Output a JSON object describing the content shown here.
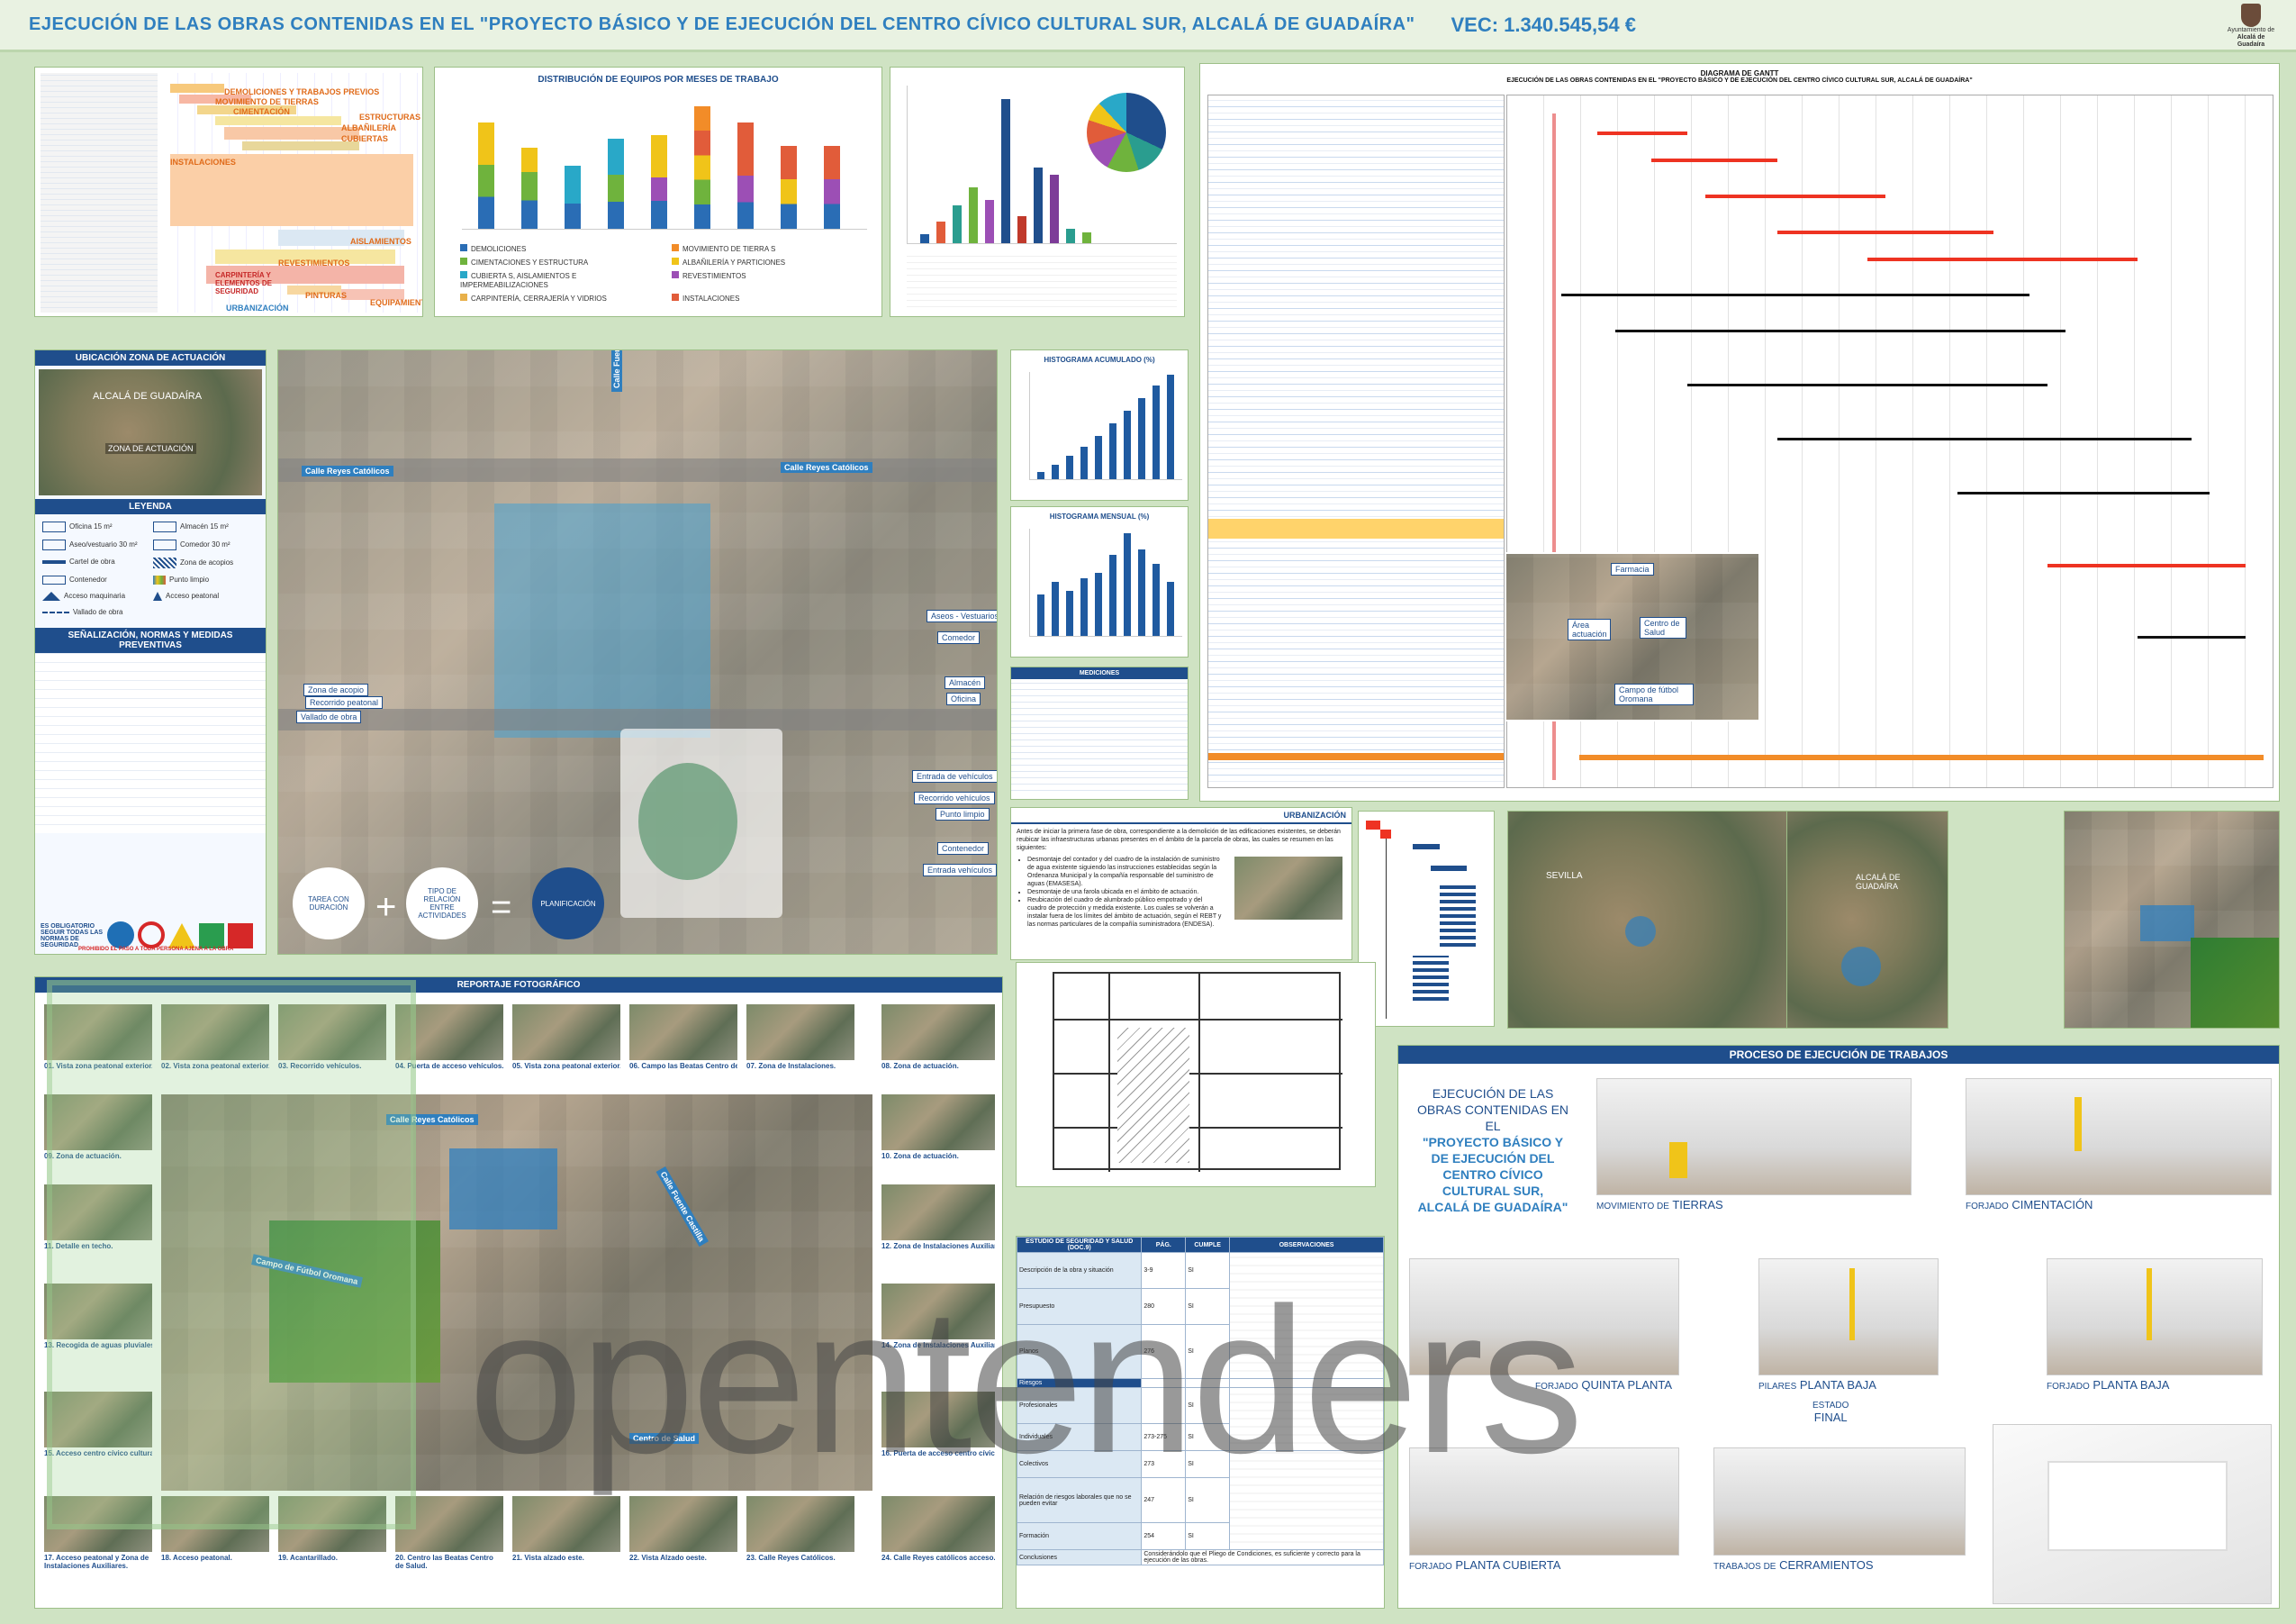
{
  "header": {
    "title": "EJECUCIÓN DE LAS OBRAS CONTENIDAS EN EL \"PROYECTO BÁSICO Y DE EJECUCIÓN DEL CENTRO CÍVICO CULTURAL SUR, ALCALÁ DE GUADAÍRA\"",
    "vec": "VEC: 1.340.545,54 €",
    "logo_line1": "Ayuntamiento de",
    "logo_line2": "Alcalá de Guadaíra"
  },
  "gantt_summary": {
    "phases": [
      "DEMOLICIONES Y TRABAJOS PREVIOS",
      "MOVIMIENTO DE TIERRAS",
      "CIMENTACIÓN",
      "ESTRUCTURAS",
      "ALBAÑILERÍA",
      "CUBIERTAS",
      "INSTALACIONES",
      "AISLAMIENTOS",
      "REVESTIMIENTOS",
      "CARPINTERÍA Y ELEMENTOS DE SEGURIDAD",
      "PINTURAS",
      "EQUIPAMIENTO",
      "URBANIZACIÓN"
    ]
  },
  "equipos_chart": {
    "title": "DISTRIBUCIÓN DE EQUIPOS POR MESES DE TRABAJO",
    "legend": [
      "DEMOLICIONES",
      "MOVIMIENTO DE TIERRA S",
      "CIMENTACIONES Y ESTRUCTURA",
      "ALBAÑILERÍA Y PARTICIONES",
      "CUBIERTA S, AISLAMIENTOS E IMPERMEABILIZACIONES",
      "REVESTIMIENTOS",
      "CARPINTERÍA, CERRAJERÍA Y VIDRIOS",
      "INSTALACIONES"
    ]
  },
  "historama": {
    "acumulado_title": "HISTOGRAMA ACUMULADO (%)",
    "mensual_title": "HISTOGRAMA MENSUAL (%)"
  },
  "gantt_big": {
    "title": "DIAGRAMA DE GANTT",
    "subtitle": "EJECUCIÓN DE LAS OBRAS CONTENIDAS EN EL \"PROYECTO BÁSICO Y DE EJECUCIÓN DEL CENTRO CÍVICO CULTURAL SUR, ALCALÁ DE GUADAÍRA\"",
    "map_labels": [
      "Farmacia",
      "Área actuación",
      "Centro de Salud",
      "Campo de fútbol Oromana"
    ]
  },
  "ubicacion": {
    "title": "UBICACIÓN ZONA DE ACTUACIÓN",
    "map_label1": "ALCALÁ DE GUADAÍRA",
    "map_label2": "ZONA DE ACTUACIÓN",
    "legend_title": "LEYENDA",
    "legend_items": [
      "Oficina 15 m²",
      "Almacén 15 m²",
      "Aseo/vestuario 30 m²",
      "Comedor 30 m²",
      "Cartel de obra",
      "Zona de acopios",
      "Contenedor",
      "Punto limpio",
      "Acceso maquinaria",
      "Acceso peatonal",
      "Vallado de obra"
    ]
  },
  "senalizacion": {
    "title": "SEÑALIZACIÓN, NORMAS Y MEDIDAS PREVENTIVAS",
    "obligatorio": "ES OBLIGATORIO SEGUIR TODAS LAS NORMAS DE SEGURIDAD",
    "prohibido": "PROHIBIDO EL PASO A TODA PERSONA AJENA A LA OBRA"
  },
  "plano": {
    "streets": [
      "Calle Reyes Católicos",
      "Calle Reyes Católicos",
      "Calle Fuente Castilla"
    ],
    "tags": [
      "Aseos - Vestuarios",
      "Comedor",
      "Zona de acopio",
      "Recorrido peatonal",
      "Vallado de obra",
      "Almacén",
      "Oficina",
      "Entrada de vehículos",
      "Recorrido vehículos",
      "Punto limpio",
      "Contenedor",
      "Entrada vehículos"
    ],
    "flow_a": "TAREA CON DURACIÓN",
    "flow_b": "TIPO DE RELACIÓN ENTRE ACTIVIDADES",
    "flow_c": "PLANIFICACIÓN"
  },
  "mediciones": {
    "title": "MEDICIONES"
  },
  "urbanizacion": {
    "title": "URBANIZACIÓN",
    "intro": "Antes de iniciar la primera fase de obra, correspondiente a la demolición de las edificaciones existentes, se deberán reubicar las infraestructuras urbanas presentes en el ámbito de la parcela de obras, las cuales se resumen en las siguientes:",
    "items": [
      "Desmontaje del contador y del cuadro de la instalación de suministro de agua existente siguiendo las instrucciones establecidas según la Ordenanza Municipal y la compañía responsable del suministro de aguas (EMASESA).",
      "Desmontaje de una farola ubicada en el ámbito de actuación.",
      "Reubicación del cuadro de alumbrado público empotrado y del cuadro de protección y medida existente. Los cuales se volverán a instalar fuera de los límites del ámbito de actuación, según el REBT y las normas particulares de la compañía suministradora (ENDESA)."
    ]
  },
  "mapas": {
    "sevilla": "SEVILLA",
    "alcala": "ALCALÁ DE GUADAÍRA"
  },
  "reportaje": {
    "title": "REPORTAJE FOTOGRÁFICO",
    "street1": "Calle Reyes Católicos",
    "street2": "Calle Fuente Castilla",
    "campo": "Campo de Fútbol Oromana",
    "centro": "Centro de Salud",
    "top_row": [
      "01. Vista zona peatonal exterior.",
      "02. Vista zona peatonal exterior.",
      "03. Recorrido vehículos.",
      "04. Puerta de acceso vehículos.",
      "05. Vista zona peatonal exterior.",
      "06. Campo las Beatas Centro de Salud.",
      "07. Zona de Instalaciones.",
      "08. Zona de actuación."
    ],
    "left_col": [
      "09. Zona de actuación.",
      "11. Detalle en techo.",
      "13. Recogida de aguas pluviales.",
      "15. Acceso centro cívico cultural."
    ],
    "right_col": [
      "10. Zona de actuación.",
      "12. Zona de Instalaciones Auxiliares.",
      "14. Zona de Instalaciones Auxiliares.",
      "16. Puerta de acceso centro cívico cultural."
    ],
    "bottom_row": [
      "17. Acceso peatonal y Zona de Instalaciones Auxiliares.",
      "18. Acceso peatonal.",
      "19. Acantarillado.",
      "20. Centro las Beatas Centro de Salud.",
      "21. Vista alzado este.",
      "22. Vista Alzado oeste.",
      "23. Calle Reyes Católicos.",
      "24. Calle Reyes católicos acceso."
    ]
  },
  "estudio": {
    "col1": "ESTUDIO DE SEGURIDAD Y SALUD (DOC.9)",
    "col2": "PÁG.",
    "col3": "CUMPLE",
    "col4": "OBSERVACIONES",
    "rows": [
      {
        "name": "Descripción de la obra y situación",
        "pag": "3-9",
        "cumple": "SI"
      },
      {
        "name": "Presupuesto",
        "pag": "280",
        "cumple": "SI"
      },
      {
        "name": "Planos",
        "pag": "276",
        "cumple": "SI"
      },
      {
        "name": "Riesgos",
        "pag": "",
        "cumple": ""
      },
      {
        "name": "Profesionales",
        "pag": "",
        "cumple": "SI"
      },
      {
        "name": "Individuales",
        "pag": "273-275",
        "cumple": "SI"
      },
      {
        "name": "Colectivos",
        "pag": "273",
        "cumple": "SI"
      },
      {
        "name": "Relación de riesgos laborales que no se pueden evitar",
        "pag": "247",
        "cumple": "SI"
      },
      {
        "name": "Formación",
        "pag": "254",
        "cumple": "SI"
      }
    ],
    "conclusiones_label": "Conclusiones",
    "conclusiones": "Considerándolo que el Pliego de Condiciones, es suficiente y correcto para la ejecución de las obras."
  },
  "proceso": {
    "title": "PROCESO DE EJECUCIÓN DE TRABAJOS",
    "intro_a": "EJECUCIÓN DE LAS OBRAS CONTENIDAS EN EL",
    "intro_b": "\"PROYECTO BÁSICO Y DE EJECUCIÓN DEL CENTRO CÍVICO CULTURAL SUR, ALCALÁ DE GUADAÍRA\"",
    "stages": [
      {
        "pre": "MOVIMIENTO DE",
        "main": "TIERRAS"
      },
      {
        "pre": "FORJADO",
        "main": "CIMENTACIÓN"
      },
      {
        "pre": "PILARES",
        "main": "PLANTA BAJA"
      },
      {
        "pre": "FORJADO",
        "main": "PLANTA BAJA"
      },
      {
        "pre": "FORJADO",
        "main": "QUINTA PLANTA"
      },
      {
        "pre": "ESTADO",
        "main": "FINAL"
      },
      {
        "pre": "FORJADO",
        "main": "PLANTA CUBIERTA"
      },
      {
        "pre": "TRABAJOS DE",
        "main": "CERRAMIENTOS"
      }
    ]
  },
  "watermark": "opentenders",
  "colors": {
    "accent": "#2f7fbf",
    "navy": "#1f4e8c",
    "background": "#cfe3c3"
  }
}
